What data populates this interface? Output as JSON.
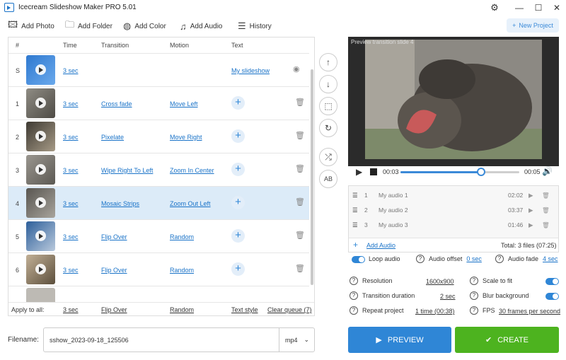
{
  "window": {
    "title": "Icecream Slideshow Maker PRO 5.01",
    "minimize": "—",
    "maximize": "☐",
    "close": "✕"
  },
  "toolbar": {
    "add_photo": "Add Photo",
    "add_folder": "Add Folder",
    "add_color": "Add Color",
    "add_audio": "Add Audio",
    "history": "History",
    "new_project": "New Project"
  },
  "table": {
    "headers": {
      "num": "#",
      "time": "Time",
      "transition": "Transition",
      "motion": "Motion",
      "text": "Text"
    },
    "rows": [
      {
        "num": "S",
        "time": "3 sec",
        "transition": "",
        "motion": "",
        "text": "My slideshow",
        "thumb": "#3f86d8"
      },
      {
        "num": "1",
        "time": "3 sec",
        "transition": "Cross fade",
        "motion": "Move Left",
        "text": "",
        "thumb": "#6b6860"
      },
      {
        "num": "2",
        "time": "3 sec",
        "transition": "Pixelate",
        "motion": "Move Right",
        "text": "",
        "thumb": "#5f5a50"
      },
      {
        "num": "3",
        "time": "3 sec",
        "transition": "Wipe Right To Left",
        "motion": "Zoom In Center",
        "text": "",
        "thumb": "#74706a"
      },
      {
        "num": "4",
        "time": "3 sec",
        "transition": "Mosaic Strips",
        "motion": "Zoom Out Left",
        "text": "",
        "thumb": "#6d6a64"
      },
      {
        "num": "5",
        "time": "3 sec",
        "transition": "Flip Over",
        "motion": "Random",
        "text": "",
        "thumb": "#4f77a8"
      },
      {
        "num": "6",
        "time": "3 sec",
        "transition": "Flip Over",
        "motion": "Random",
        "text": "",
        "thumb": "#8a7a62"
      }
    ],
    "apply_row": {
      "label": "Apply to all:",
      "time": "3 sec",
      "transition": "Flip Over",
      "motion": "Random",
      "text": "Text style",
      "clear": "Clear queue (7)"
    }
  },
  "filename": {
    "label": "Filename:",
    "value": "sshow_2023-09-18_125506",
    "format": "mp4"
  },
  "preview": {
    "caption": "Preview transition slide 4",
    "current_time": "00:03",
    "total_time": "00:05",
    "progress": 0.68
  },
  "audio": {
    "tracks": [
      {
        "num": "1",
        "name": "My audio 1",
        "duration": "02:02"
      },
      {
        "num": "2",
        "name": "My audio 2",
        "duration": "03:37"
      },
      {
        "num": "3",
        "name": "My audio 3",
        "duration": "01:46"
      }
    ],
    "add_audio": "Add Audio",
    "total": "Total: 3 files (07:25)",
    "loop_label": "Loop audio",
    "offset_label": "Audio offset",
    "offset_value": "0 sec",
    "fade_label": "Audio fade",
    "fade_value": "4 sec"
  },
  "settings": {
    "resolution_label": "Resolution",
    "resolution_value": "1600x900",
    "transition_label": "Transition duration",
    "transition_value": "2 sec",
    "repeat_label": "Repeat project",
    "repeat_value": "1 time (00:38)",
    "scale_label": "Scale to fit",
    "blur_label": "Blur background",
    "fps_label": "FPS",
    "fps_value": "30 frames per second"
  },
  "buttons": {
    "preview": "PREVIEW",
    "create": "CREATE"
  },
  "colors": {
    "accent": "#2f86d6",
    "create": "#4db31f",
    "selected_row": "#dcebf8"
  }
}
